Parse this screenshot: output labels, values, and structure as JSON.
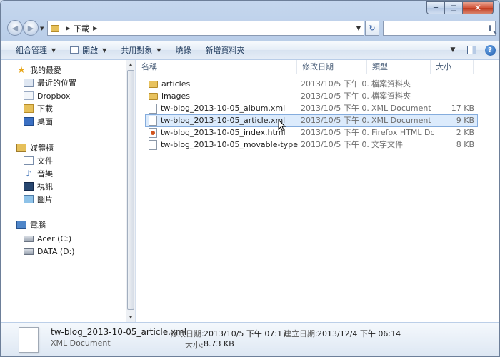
{
  "window": {
    "min_label": "─",
    "max_label": "□",
    "close_label": "✕"
  },
  "address": {
    "crumb": "下載",
    "search_placeholder": ""
  },
  "toolbar": {
    "organize": "組合管理",
    "open": "開啟",
    "share": "共用對象",
    "burn": "燒錄",
    "new_folder": "新增資料夾"
  },
  "nav": {
    "favorites": "我的最愛",
    "recent": "最近的位置",
    "dropbox": "Dropbox",
    "downloads": "下載",
    "desktop": "桌面",
    "libraries": "媒體櫃",
    "documents": "文件",
    "music": "音樂",
    "videos": "視訊",
    "pictures": "圖片",
    "computer": "電腦",
    "drive_c": "Acer (C:)",
    "drive_d": "DATA (D:)"
  },
  "columns": {
    "name": "名稱",
    "date": "修改日期",
    "type": "類型",
    "size": "大小"
  },
  "files": [
    {
      "name": "articles",
      "date": "2013/10/5 下午 0...",
      "type": "檔案資料夾",
      "size": "",
      "icon": "folder"
    },
    {
      "name": "images",
      "date": "2013/10/5 下午 0...",
      "type": "檔案資料夾",
      "size": "",
      "icon": "folder"
    },
    {
      "name": "tw-blog_2013-10-05_album.xml",
      "date": "2013/10/5 下午 0...",
      "type": "XML Document",
      "size": "17 KB",
      "icon": "xml"
    },
    {
      "name": "tw-blog_2013-10-05_article.xml",
      "date": "2013/10/5 下午 0...",
      "type": "XML Document",
      "size": "9 KB",
      "icon": "xml"
    },
    {
      "name": "tw-blog_2013-10-05_index.html",
      "date": "2013/10/5 下午 0...",
      "type": "Firefox HTML Do...",
      "size": "2 KB",
      "icon": "html"
    },
    {
      "name": "tw-blog_2013-10-05_movable-type.txt",
      "date": "2013/10/5 下午 0...",
      "type": "文字文件",
      "size": "8 KB",
      "icon": "txt"
    }
  ],
  "details": {
    "name": "tw-blog_2013-10-05_article.xml",
    "type": "XML Document",
    "modified_label": "修改日期:",
    "modified_value": "2013/10/5 下午 07:17",
    "created_label": "建立日期:",
    "created_value": "2013/12/4 下午 06:14",
    "size_label": "大小:",
    "size_value": "8.73 KB"
  }
}
